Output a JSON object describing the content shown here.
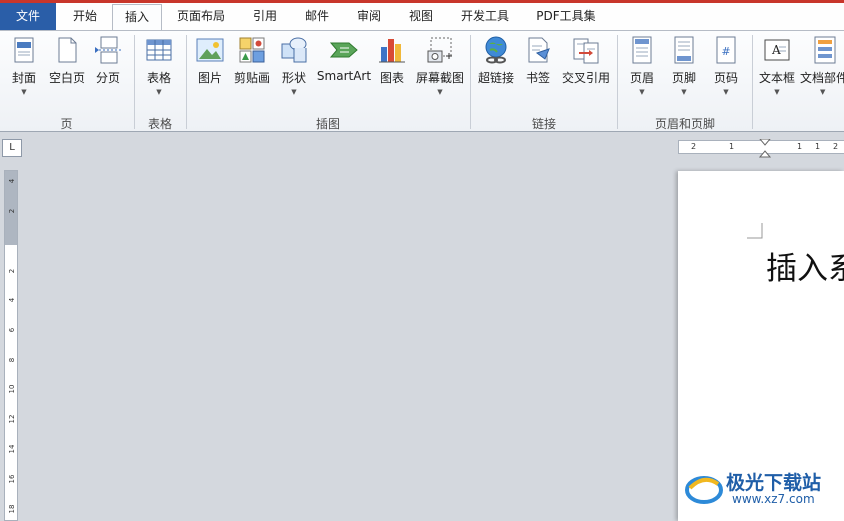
{
  "tabs": [
    {
      "label": "文件"
    },
    {
      "label": "开始"
    },
    {
      "label": "插入"
    },
    {
      "label": "页面布局"
    },
    {
      "label": "引用"
    },
    {
      "label": "邮件"
    },
    {
      "label": "审阅"
    },
    {
      "label": "视图"
    },
    {
      "label": "开发工具"
    },
    {
      "label": "PDF工具集"
    }
  ],
  "ribbon": {
    "groups": {
      "page": "页",
      "table": "表格",
      "illustrations": "插图",
      "links": "链接",
      "header_footer": "页眉和页脚"
    },
    "buttons": {
      "cover": "封面",
      "blank_page": "空白页",
      "page_break": "分页",
      "table": "表格",
      "picture": "图片",
      "clipart": "剪贴画",
      "shapes": "形状",
      "smartart": "SmartArt",
      "chart": "图表",
      "screenshot": "屏幕截图",
      "hyperlink": "超链接",
      "bookmark": "书签",
      "cross_ref": "交叉引用",
      "header": "页眉",
      "footer": "页脚",
      "page_number": "页码",
      "textbox": "文本框",
      "quick_parts": "文档部件"
    }
  },
  "ruler": {
    "corner": "L",
    "vertical_ticks": [
      "4",
      "2",
      "2",
      "4",
      "6",
      "8",
      "10",
      "12",
      "14",
      "16",
      "18"
    ],
    "horizontal_ticks": [
      "2",
      "1",
      "1",
      "1",
      "2"
    ]
  },
  "document": {
    "text": "插入系"
  },
  "watermark": {
    "name": "极光下载站",
    "url": "www.xz7.com"
  }
}
